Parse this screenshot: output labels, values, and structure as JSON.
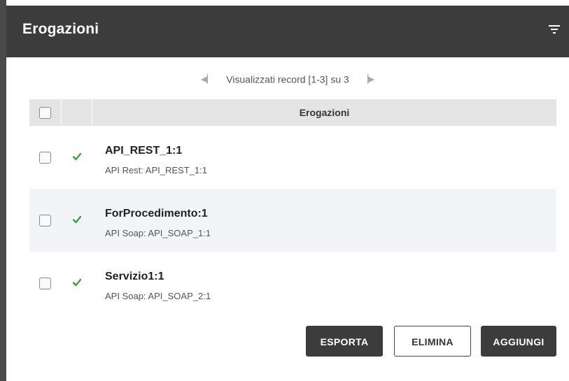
{
  "header": {
    "title": "Erogazioni",
    "filter_icon": "filter-icon"
  },
  "pager": {
    "first_icon": "first-page-icon",
    "text": "Visualizzati record [1-3] su 3",
    "last_icon": "last-page-icon"
  },
  "table": {
    "column_header": "Erogazioni",
    "rows": [
      {
        "title": "API_REST_1:1",
        "subtitle": "API Rest: API_REST_1:1",
        "status": "ok",
        "status_color": "#3aa33a"
      },
      {
        "title": "ForProcedimento:1",
        "subtitle": "API Soap: API_SOAP_1:1",
        "status": "ok",
        "status_color": "#3aa33a"
      },
      {
        "title": "Servizio1:1",
        "subtitle": "API Soap: API_SOAP_2:1",
        "status": "ok",
        "status_color": "#3aa33a"
      }
    ]
  },
  "actions": {
    "export_label": "ESPORTA",
    "delete_label": "ELIMINA",
    "add_label": "AGGIUNGI"
  },
  "colors": {
    "header_bg": "#3c3c3c",
    "row_alt_bg": "#f3f4f7",
    "status_ok": "#3aa33a"
  }
}
